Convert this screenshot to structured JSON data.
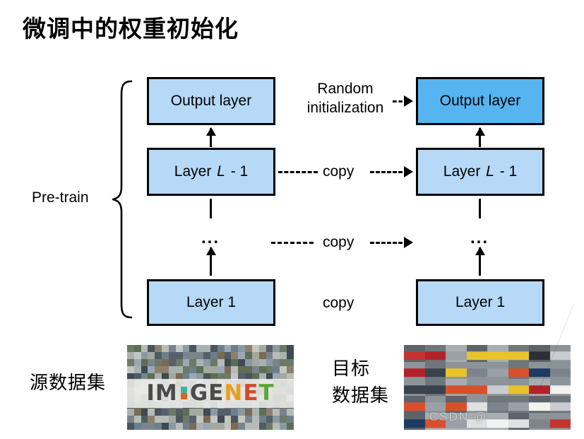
{
  "slide": {
    "title": "微调中的权重初始化",
    "background_color": "#ffffff"
  },
  "colors": {
    "box_light_blue": "#b5d9f7",
    "box_strong_blue": "#56b4f0",
    "box_border": "#000000",
    "text": "#000000"
  },
  "diagram": {
    "pretrain_label": "Pre-train",
    "source_column": {
      "boxes": [
        {
          "label": "Output layer",
          "fill": "light"
        },
        {
          "label_prefix": "Layer ",
          "label_italic": "L",
          "label_suffix": " - 1",
          "fill": "light"
        },
        {
          "label": "...",
          "fill": "none"
        },
        {
          "label": "Layer 1",
          "fill": "light"
        }
      ]
    },
    "target_column": {
      "boxes": [
        {
          "label": "Output layer",
          "fill": "strong"
        },
        {
          "label_prefix": "Layer ",
          "label_italic": "L",
          "label_suffix": " - 1",
          "fill": "light"
        },
        {
          "label": "...",
          "fill": "none"
        },
        {
          "label": "Layer 1",
          "fill": "light"
        }
      ]
    },
    "connectors": [
      {
        "label_line1": "Random",
        "label_line2": "initialization",
        "style": "dashed-arrow",
        "row": "output-layer"
      },
      {
        "label": "copy",
        "style": "dashed-arrow",
        "row": "layer-L-1"
      },
      {
        "label": "copy",
        "style": "dashed-arrow",
        "row": "ellipsis"
      },
      {
        "label": "copy",
        "style": "text-only",
        "row": "layer-1"
      }
    ]
  },
  "datasets": {
    "source": {
      "caption": "源数据集",
      "image_name": "imagenet-mosaic",
      "logo_text": "IM GENET"
    },
    "target": {
      "caption_line1": "目标",
      "caption_line2": "数据集",
      "image_name": "cars-grid"
    }
  },
  "watermark": {
    "text": "CSDN @"
  }
}
